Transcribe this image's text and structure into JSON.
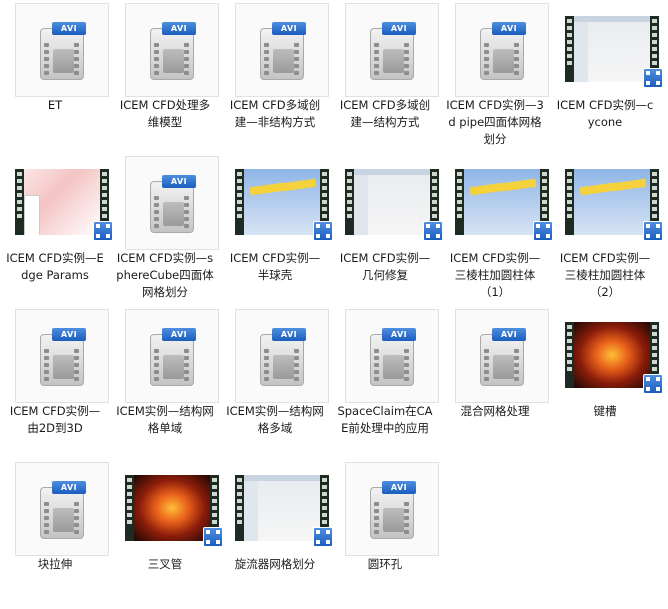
{
  "items": [
    {
      "label": "ET",
      "type": "avi"
    },
    {
      "label": "ICEM CFD处理多维模型",
      "type": "avi"
    },
    {
      "label": "ICEM CFD多域创建—非结构方式",
      "type": "avi"
    },
    {
      "label": "ICEM CFD多域创建—结构方式",
      "type": "avi"
    },
    {
      "label": "ICEM CFD实例—3d pipe四面体网格划分",
      "type": "avi"
    },
    {
      "label": "ICEM CFD实例—cycone",
      "type": "video",
      "thumb": "white"
    },
    {
      "label": "ICEM CFD实例—Edge Params",
      "type": "video",
      "thumb": "pink"
    },
    {
      "label": "ICEM CFD实例—sphereCube四面体网格划分",
      "type": "avi"
    },
    {
      "label": "ICEM CFD实例—半球壳",
      "type": "video",
      "thumb": "blue"
    },
    {
      "label": "ICEM CFD实例—几何修复",
      "type": "video",
      "thumb": "white"
    },
    {
      "label": "ICEM CFD实例—三棱柱加圆柱体（1）",
      "type": "video",
      "thumb": "blue"
    },
    {
      "label": "ICEM CFD实例—三棱柱加圆柱体（2）",
      "type": "video",
      "thumb": "blue"
    },
    {
      "label": "ICEM CFD实例—由2D到3D",
      "type": "avi"
    },
    {
      "label": "ICEM实例—结构网格单域",
      "type": "avi"
    },
    {
      "label": "ICEM实例—结构网格多域",
      "type": "avi"
    },
    {
      "label": "SpaceClaim在CAE前处理中的应用",
      "type": "avi"
    },
    {
      "label": "混合网格处理",
      "type": "avi"
    },
    {
      "label": "键槽",
      "type": "video",
      "thumb": "fire"
    },
    {
      "label": "块拉伸",
      "type": "avi"
    },
    {
      "label": "三叉管",
      "type": "video",
      "thumb": "fire"
    },
    {
      "label": "旋流器网格划分",
      "type": "video",
      "thumb": "white"
    },
    {
      "label": "圆环孔",
      "type": "avi"
    }
  ],
  "avi_badge_text": "AVI"
}
